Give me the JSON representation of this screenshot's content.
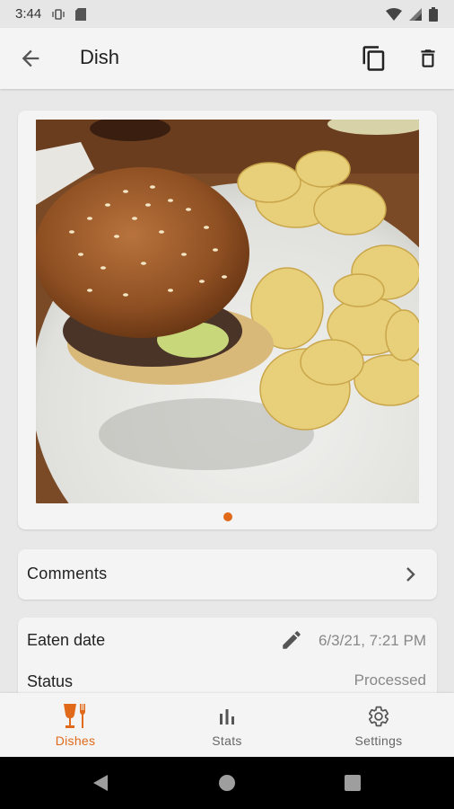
{
  "status_bar": {
    "time": "3:44",
    "icons": [
      "signal-vibrate-icon",
      "sd-card-icon",
      "wifi-icon",
      "cellular-icon",
      "battery-icon"
    ]
  },
  "app_bar": {
    "title": "Dish",
    "back_icon": "arrow-back-icon",
    "actions": [
      "copy-icon",
      "delete-icon"
    ]
  },
  "photo": {
    "alt": "",
    "page_count": 1,
    "current_page": 1
  },
  "comments": {
    "label": "Comments"
  },
  "details": {
    "eaten_date_label": "Eaten date",
    "eaten_date_value": "6/3/21, 7:21 PM",
    "status_label": "Status",
    "status_value": "Processed"
  },
  "bottom_nav": {
    "items": [
      {
        "label": "Dishes",
        "icon": "dishes-icon",
        "active": true
      },
      {
        "label": "Stats",
        "icon": "bar-chart-icon",
        "active": false
      },
      {
        "label": "Settings",
        "icon": "gear-icon",
        "active": false
      }
    ]
  },
  "colors": {
    "accent": "#e06a1a",
    "surface": "#f4f4f4",
    "background": "#e8e8e8"
  }
}
